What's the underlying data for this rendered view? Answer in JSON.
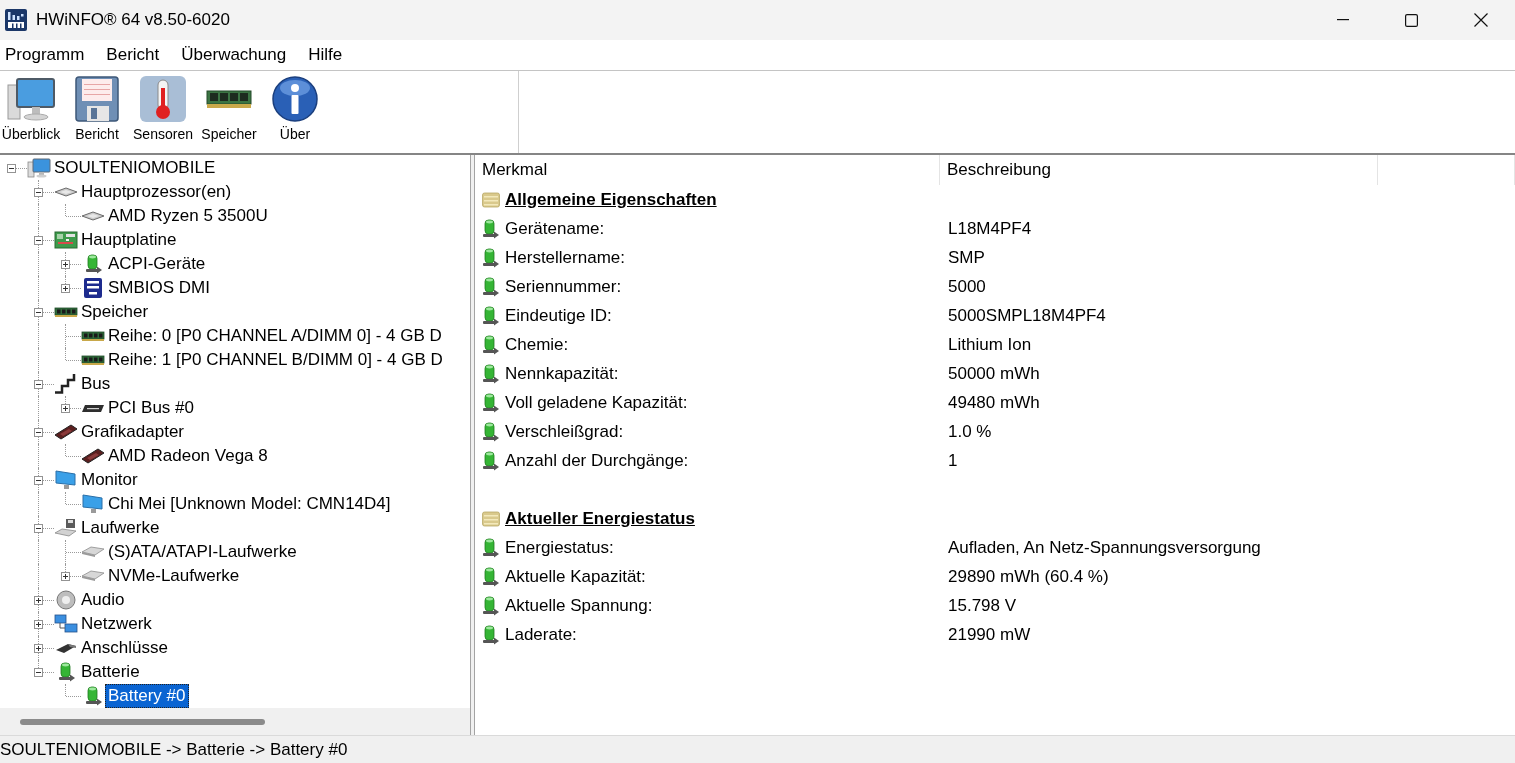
{
  "window": {
    "title": "HWiNFO® 64 v8.50-6020"
  },
  "menu": [
    "Programm",
    "Bericht",
    "Überwachung",
    "Hilfe"
  ],
  "toolbar": [
    {
      "label": "Überblick",
      "kind": "computer"
    },
    {
      "label": "Bericht",
      "kind": "floppy"
    },
    {
      "label": "Sensoren",
      "kind": "thermometer"
    },
    {
      "label": "Speicher",
      "kind": "memory"
    },
    {
      "label": "Über",
      "kind": "info"
    }
  ],
  "tree": [
    {
      "label": "SOULTENIOMOBILE",
      "kind": "computer",
      "expanded": true,
      "selected": false,
      "children": [
        {
          "label": "Hauptprozessor(en)",
          "kind": "cpu",
          "expanded": true,
          "selected": false,
          "children": [
            {
              "label": "AMD Ryzen 5 3500U",
              "kind": "cpu",
              "selected": false
            }
          ]
        },
        {
          "label": "Hauptplatine",
          "kind": "board",
          "expanded": true,
          "selected": false,
          "children": [
            {
              "label": "ACPI-Geräte",
              "kind": "battery",
              "expanded": false,
              "selected": false
            },
            {
              "label": "SMBIOS DMI",
              "kind": "dmi",
              "expanded": false,
              "selected": false
            }
          ]
        },
        {
          "label": "Speicher",
          "kind": "memory",
          "expanded": true,
          "selected": false,
          "children": [
            {
              "label": "Reihe: 0 [P0 CHANNEL A/DIMM 0] - 4 GB D",
              "kind": "memory",
              "selected": false
            },
            {
              "label": "Reihe: 1 [P0 CHANNEL B/DIMM 0] - 4 GB D",
              "kind": "memory",
              "selected": false
            }
          ]
        },
        {
          "label": "Bus",
          "kind": "bus",
          "expanded": true,
          "selected": false,
          "children": [
            {
              "label": "PCI Bus #0",
              "kind": "pci",
              "expanded": false,
              "selected": false
            }
          ]
        },
        {
          "label": "Grafikadapter",
          "kind": "gpu",
          "expanded": true,
          "selected": false,
          "children": [
            {
              "label": "AMD Radeon Vega 8",
              "kind": "gpu",
              "selected": false
            }
          ]
        },
        {
          "label": "Monitor",
          "kind": "monitor",
          "expanded": true,
          "selected": false,
          "children": [
            {
              "label": "Chi Mei [Unknown Model: CMN14D4]",
              "kind": "monitor",
              "selected": false
            }
          ]
        },
        {
          "label": "Laufwerke",
          "kind": "drives",
          "expanded": true,
          "selected": false,
          "children": [
            {
              "label": "(S)ATA/ATAPI-Laufwerke",
              "kind": "disk",
              "selected": false
            },
            {
              "label": "NVMe-Laufwerke",
              "kind": "disk",
              "expanded": false,
              "selected": false
            }
          ]
        },
        {
          "label": "Audio",
          "kind": "audio",
          "expanded": false,
          "selected": false
        },
        {
          "label": "Netzwerk",
          "kind": "network",
          "expanded": false,
          "selected": false
        },
        {
          "label": "Anschlüsse",
          "kind": "ports",
          "expanded": false,
          "selected": false
        },
        {
          "label": "Batterie",
          "kind": "battery",
          "expanded": true,
          "selected": false,
          "children": [
            {
              "label": "Battery #0",
              "kind": "battery",
              "selected": true
            }
          ]
        }
      ]
    }
  ],
  "table": {
    "columns": [
      "Merkmal",
      "Beschreibung"
    ],
    "sections": [
      {
        "title": "Allgemeine Eigenschaften",
        "rows": [
          {
            "label": "Gerätename:",
            "value": "L18M4PF4"
          },
          {
            "label": "Herstellername:",
            "value": "SMP"
          },
          {
            "label": "Seriennummer:",
            "value": "5000"
          },
          {
            "label": "Eindeutige ID:",
            "value": "5000SMPL18M4PF4"
          },
          {
            "label": "Chemie:",
            "value": "Lithium Ion"
          },
          {
            "label": "Nennkapazität:",
            "value": "50000 mWh"
          },
          {
            "label": "Voll geladene Kapazität:",
            "value": "49480 mWh"
          },
          {
            "label": "Verschleißgrad:",
            "value": "1.0 %"
          },
          {
            "label": "Anzahl der Durchgänge:",
            "value": "1"
          }
        ]
      },
      {
        "title": "Aktueller Energiestatus",
        "rows": [
          {
            "label": "Energiestatus:",
            "value": "Aufladen, An Netz-Spannungsversorgung"
          },
          {
            "label": "Aktuelle Kapazität:",
            "value": "29890 mWh (60.4 %)"
          },
          {
            "label": "Aktuelle Spannung:",
            "value": "15.798 V"
          },
          {
            "label": "Laderate:",
            "value": "21990 mW"
          }
        ]
      }
    ]
  },
  "status_bar": "SOULTENIOMOBILE -> Batterie -> Battery #0"
}
